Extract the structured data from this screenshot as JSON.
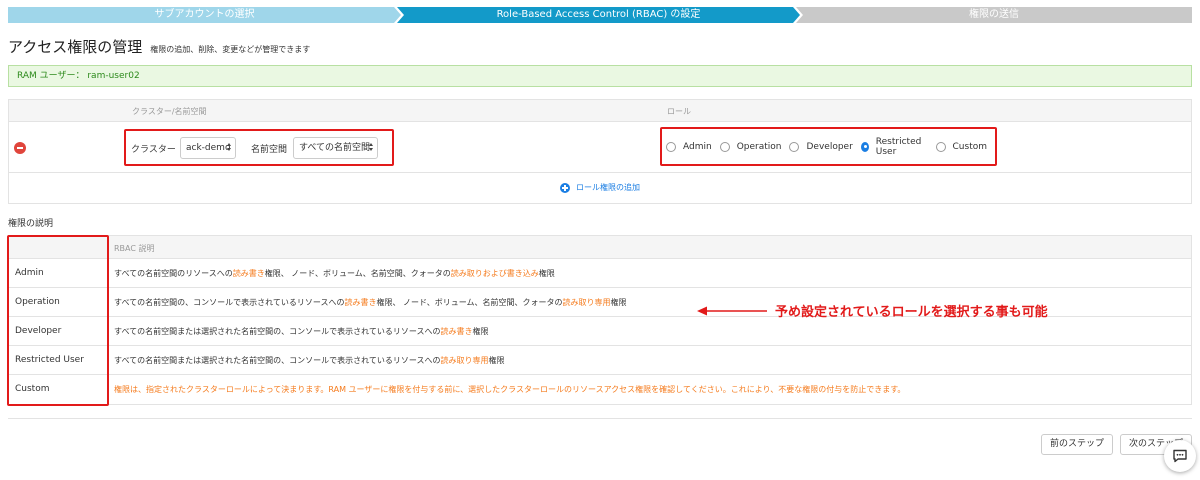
{
  "stepper": {
    "step1": "サブアカウントの選択",
    "step2": "Role-Based Access Control (RBAC) の設定",
    "step3": "権限の送信"
  },
  "header": {
    "title": "アクセス権限の管理",
    "subtitle": "権限の追加、削除、変更などが管理できます"
  },
  "ram_user": "RAM ユーザー： ram-user02",
  "role_table": {
    "col_cluster_ns": "クラスター/名前空間",
    "col_role": "ロール",
    "cluster_label": "クラスター",
    "cluster_value": "ack-demo",
    "namespace_label": "名前空間",
    "namespace_value": "すべての名前空間",
    "roles": [
      {
        "label": "Admin",
        "checked": false
      },
      {
        "label": "Operation",
        "checked": false
      },
      {
        "label": "Developer",
        "checked": false
      },
      {
        "label": "Restricted User",
        "checked": true
      },
      {
        "label": "Custom",
        "checked": false
      }
    ],
    "add_role": "ロール権限の追加"
  },
  "permissions": {
    "title": "権限の説明",
    "col_desc": "RBAC 説明",
    "rows": [
      {
        "name": "Admin",
        "parts": [
          {
            "t": "すべての名前空間のリソースへの"
          },
          {
            "t": "読み書き",
            "hl": true
          },
          {
            "t": "権限、 ノード、ボリューム、名前空間、クォータの"
          },
          {
            "t": "読み取りおよび書き込み",
            "hl": true
          },
          {
            "t": "権限"
          }
        ]
      },
      {
        "name": "Operation",
        "parts": [
          {
            "t": "すべての名前空間の、コンソールで表示されているリソースへの"
          },
          {
            "t": "読み書き",
            "hl": true
          },
          {
            "t": "権限、 ノード、ボリューム、名前空間、クォータの"
          },
          {
            "t": "読み取り専用",
            "hl": true
          },
          {
            "t": "権限"
          }
        ]
      },
      {
        "name": "Developer",
        "parts": [
          {
            "t": "すべての名前空間または選択された名前空間の、コンソールで表示されているリソースへの"
          },
          {
            "t": "読み書き",
            "hl": true
          },
          {
            "t": "権限"
          }
        ]
      },
      {
        "name": "Restricted User",
        "parts": [
          {
            "t": "すべての名前空間または選択された名前空間の、コンソールで表示されているリソースへの"
          },
          {
            "t": "読み取り専用",
            "hl": true
          },
          {
            "t": "権限"
          }
        ]
      },
      {
        "name": "Custom",
        "parts": [
          {
            "t": "権限は、指定されたクラスターロールによって決まります。RAM ユーザーに権限を付与する前に、選択したクラスターロールのリソースアクセス権限を確認してください。これにより、不要な権限の付与を防止できます。",
            "hl": true
          }
        ]
      }
    ]
  },
  "annotation": "予め設定されているロールを選択する事も可能",
  "footer": {
    "prev": "前のステップ",
    "next": "次のステップ"
  },
  "colors": {
    "accent": "#139ac9",
    "highlight": "#f57c1f",
    "annotation": "#e21a1a"
  }
}
